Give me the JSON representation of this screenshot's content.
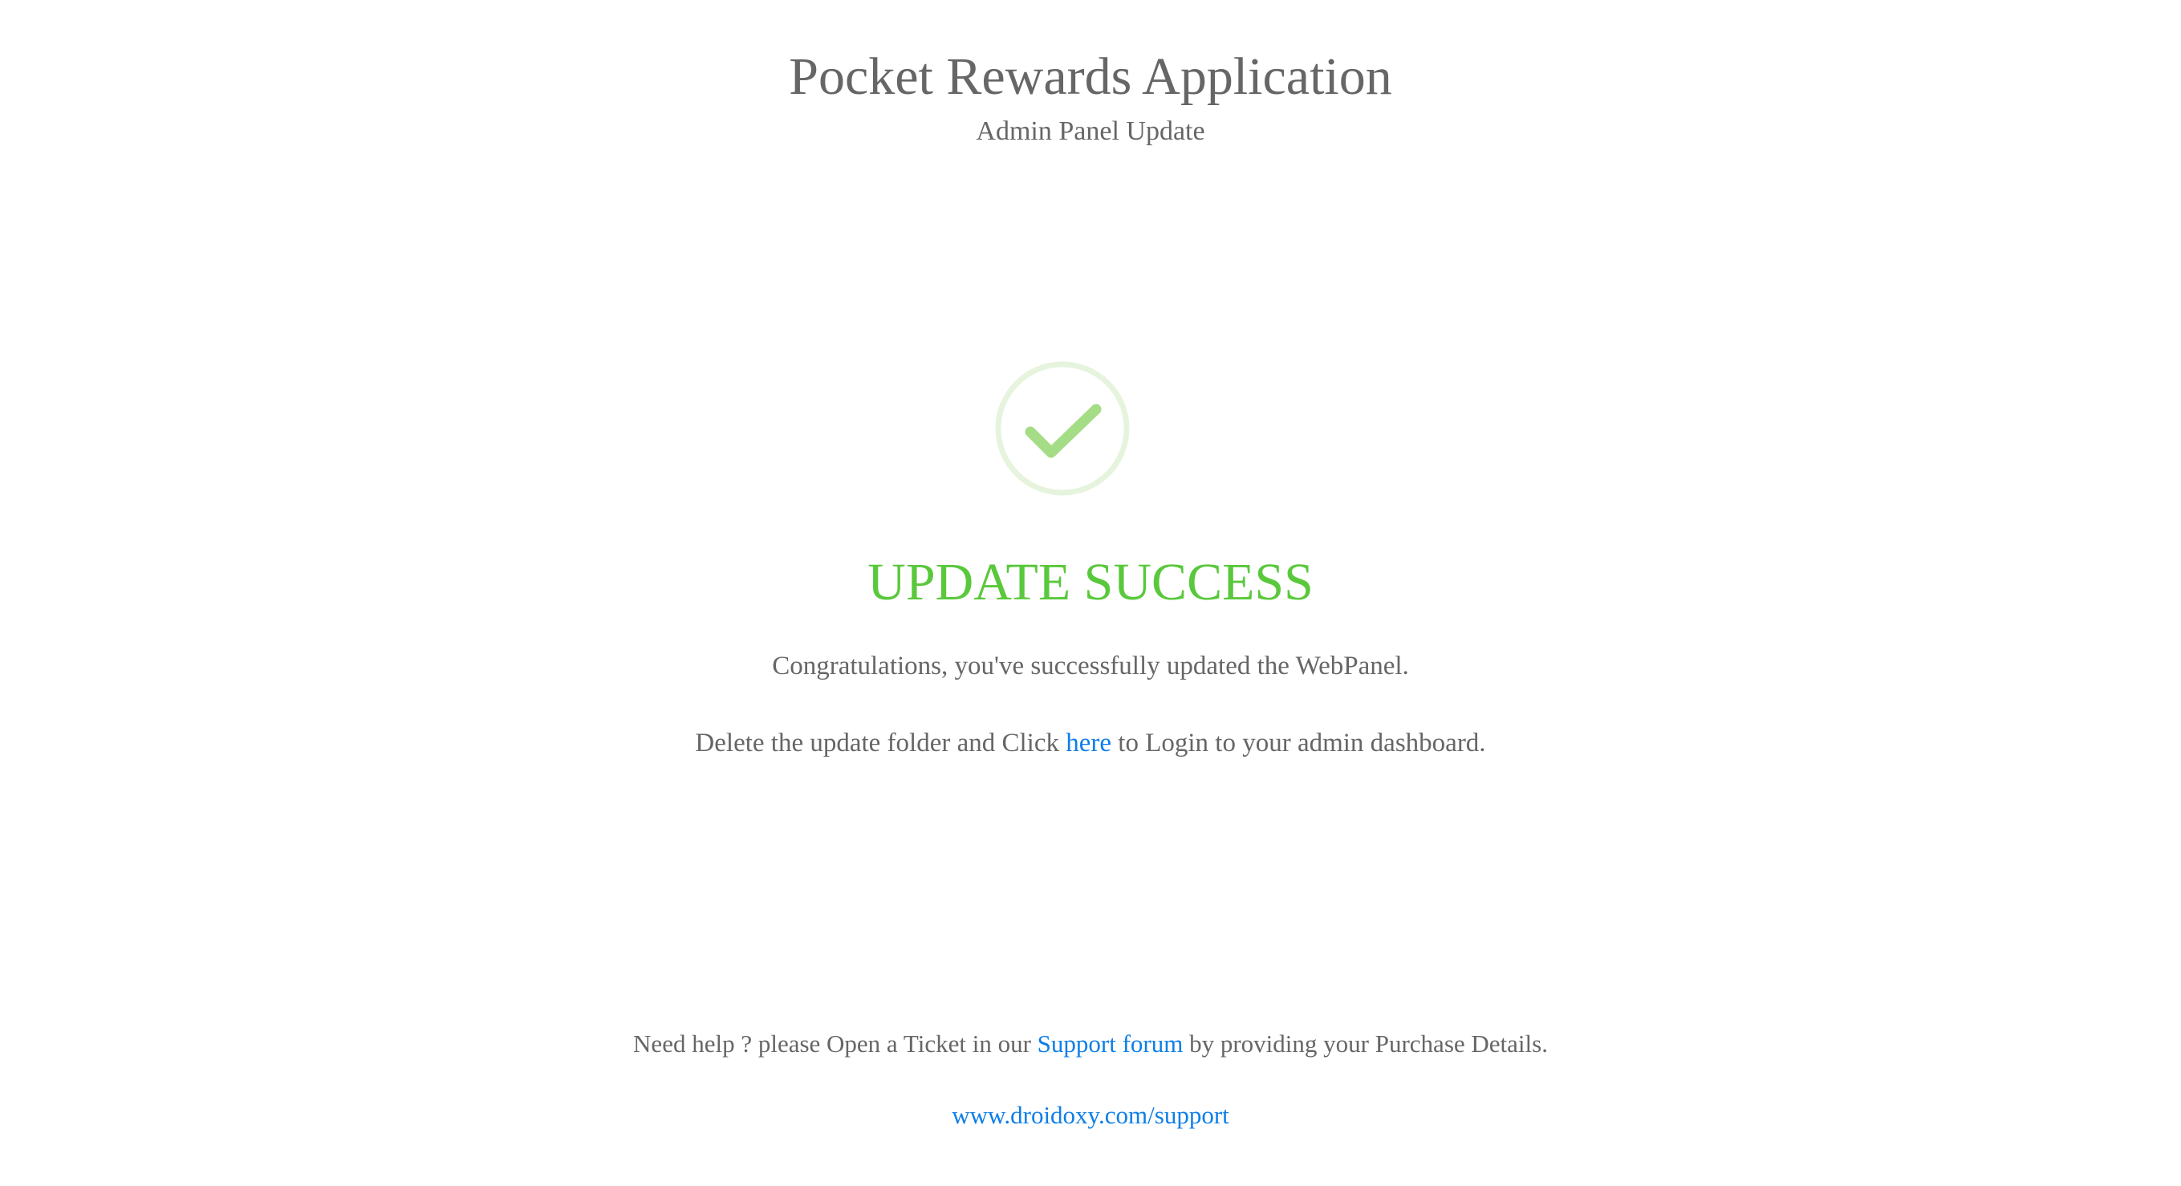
{
  "header": {
    "title": "Pocket Rewards Application",
    "subtitle": "Admin Panel Update"
  },
  "status": {
    "icon": "checkmark-circle-icon",
    "heading": "UPDATE SUCCESS",
    "message": "Congratulations, you've successfully updated the WebPanel.",
    "instruction_before": "Delete the update folder and Click ",
    "instruction_link": "here",
    "instruction_after": " to Login to your admin dashboard."
  },
  "footer": {
    "help_before": "Need help ? please Open a Ticket in our ",
    "help_link": "Support forum",
    "help_after": " by providing your Purchase Details.",
    "support_url": "www.droidoxy.com/support"
  },
  "colors": {
    "success_green": "#5ac83c",
    "icon_green": "#a5dc86",
    "icon_ring": "#e6f4dd",
    "link_blue": "#0d7ee8",
    "text_gray": "#666666"
  }
}
